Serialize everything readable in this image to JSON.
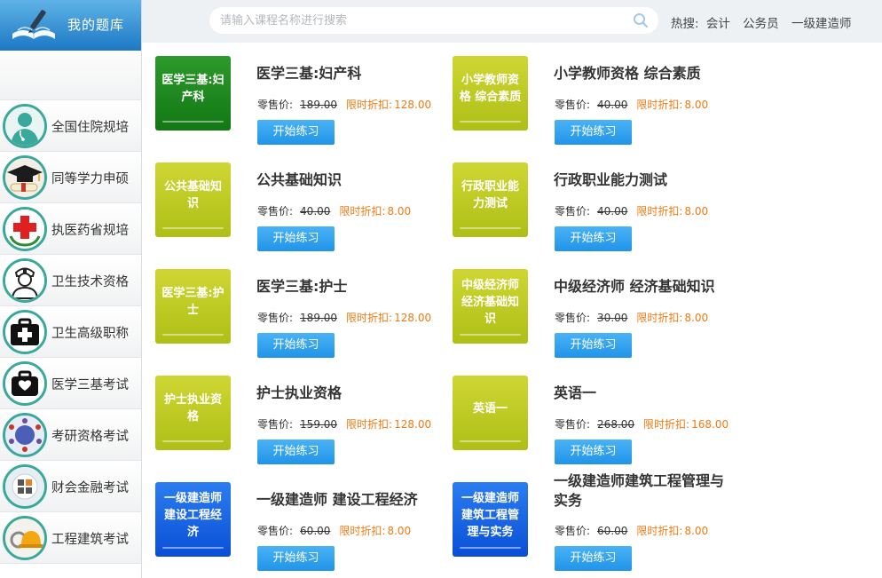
{
  "sidebar": {
    "title": "我的题库",
    "items": [
      {
        "label": "全国住院规培",
        "icon": "doctor-icon"
      },
      {
        "label": "同等学力申硕",
        "icon": "graduation-cap-icon"
      },
      {
        "label": "执医药省规培",
        "icon": "red-cross-icon"
      },
      {
        "label": "卫生技术资格",
        "icon": "nurse-icon"
      },
      {
        "label": "卫生高级职称",
        "icon": "medical-kit-icon"
      },
      {
        "label": "医学三基考试",
        "icon": "medical-bag-icon"
      },
      {
        "label": "考研资格考试",
        "icon": "globe-people-icon"
      },
      {
        "label": "财会金融考试",
        "icon": "calculator-icon"
      },
      {
        "label": "工程建筑考试",
        "icon": "hardhat-icon"
      }
    ]
  },
  "search": {
    "placeholder": "请输入课程名称进行搜索"
  },
  "hot": {
    "label": "热搜:",
    "items": [
      "会计",
      "公务员",
      "一级建造师"
    ]
  },
  "labels": {
    "retail": "零售价:",
    "discount": "限时折扣:",
    "start": "开始练习"
  },
  "colors": {
    "accent": "#2094e8",
    "discount": "#f07a12",
    "green": "#1a8a1c",
    "lime": "#bccb20",
    "blue": "#0a55e0"
  },
  "courses": [
    {
      "thumb": "医学三基:妇产科",
      "title": "医学三基:妇产科",
      "price": "189.00",
      "discount": "128.00",
      "color": "green"
    },
    {
      "thumb": "小学教师资格 综合素质",
      "title": "小学教师资格 综合素质",
      "price": "40.00",
      "discount": "8.00",
      "color": "lime"
    },
    {
      "thumb": "公共基础知识",
      "title": "公共基础知识",
      "price": "40.00",
      "discount": "8.00",
      "color": "lime"
    },
    {
      "thumb": "行政职业能力测试",
      "title": "行政职业能力测试",
      "price": "40.00",
      "discount": "8.00",
      "color": "lime"
    },
    {
      "thumb": "医学三基:护士",
      "title": "医学三基:护士",
      "price": "189.00",
      "discount": "128.00",
      "color": "lime"
    },
    {
      "thumb": "中级经济师经济基础知识",
      "title": "中级经济师 经济基础知识",
      "price": "30.00",
      "discount": "8.00",
      "color": "lime"
    },
    {
      "thumb": "护士执业资格",
      "title": "护士执业资格",
      "price": "159.00",
      "discount": "128.00",
      "color": "lime"
    },
    {
      "thumb": "英语一",
      "title": "英语一",
      "price": "268.00",
      "discount": "168.00",
      "color": "lime"
    },
    {
      "thumb": "一级建造师建设工程经济",
      "title": "一级建造师 建设工程经济",
      "price": "60.00",
      "discount": "8.00",
      "color": "blue"
    },
    {
      "thumb": "一级建造师建筑工程管理与实务",
      "title": "一级建造师建筑工程管理与实务",
      "price": "60.00",
      "discount": "8.00",
      "color": "blue"
    }
  ]
}
